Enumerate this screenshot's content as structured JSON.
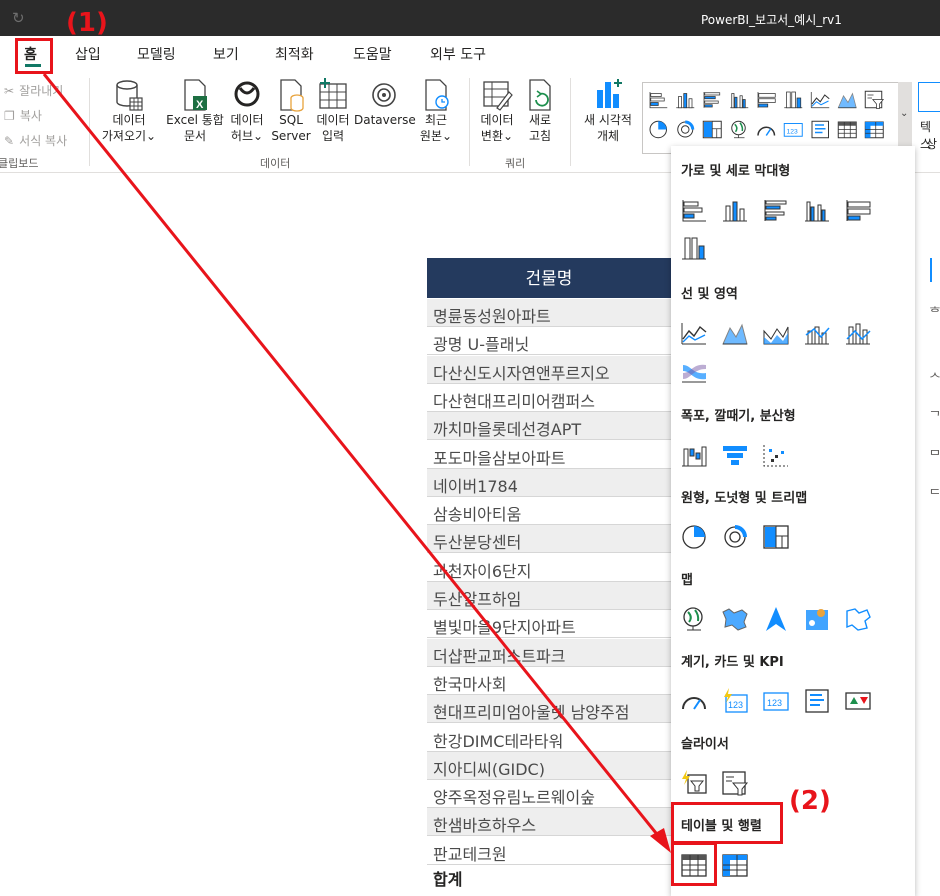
{
  "window": {
    "title": "PowerBI_보고서_예시_rv1"
  },
  "menu": {
    "tabs": [
      "홈",
      "삽입",
      "모델링",
      "보기",
      "최적화",
      "도움말",
      "외부 도구"
    ],
    "active": "홈"
  },
  "ribbon": {
    "clipboard": {
      "cut": "잘라내기",
      "copy": "복사",
      "format_painter": "서식 복사",
      "group": "클립보드"
    },
    "data": {
      "get_data": [
        "데이터",
        "가져오기⌄"
      ],
      "excel": [
        "Excel 통합",
        "문서"
      ],
      "data_hub": [
        "데이터",
        "허브⌄"
      ],
      "sql": [
        "SQL",
        "Server"
      ],
      "enter_data": [
        "데이터",
        "입력"
      ],
      "dataverse": "Dataverse",
      "recent": [
        "최근",
        "원본⌄"
      ],
      "group": "데이터"
    },
    "query": {
      "transform": [
        "데이터",
        "변환⌄"
      ],
      "refresh": [
        "새로",
        "고침"
      ],
      "group": "쿼리"
    },
    "insert": {
      "new_visual": [
        "새 시각적",
        "개체"
      ]
    },
    "text_clip": [
      "텍스",
      "상"
    ]
  },
  "table": {
    "header": "건물명",
    "rows": [
      "명륜동성원아파트",
      "광명 U-플래닛",
      "다산신도시자연앤푸르지오",
      "다산현대프리미어캠퍼스",
      "까치마을롯데선경APT",
      "포도마을삼보아파트",
      "네이버1784",
      "삼송비아티움",
      "두산분당센터",
      "과천자이6단지",
      "두산알프하임",
      "별빛마을9단지아파트",
      "더샵판교퍼스트파크",
      "한국마사회",
      "현대프리미엄아울렛 남양주점",
      "한강DIMC테라타워",
      "지아디씨(GIDC)",
      "양주옥정유림노르웨이숲",
      "한샘바흐하우스",
      "판교테크원"
    ],
    "total_label": "합계"
  },
  "viz_panel": {
    "sections": [
      {
        "title": "가로 및 세로 막대형",
        "icons": [
          "stacked-bar-icon",
          "stacked-column-icon",
          "clustered-bar-icon",
          "clustered-column-icon",
          "100-stacked-bar-icon",
          "100-stacked-column-icon"
        ]
      },
      {
        "title": "선 및 영역",
        "icons": [
          "line-chart-icon",
          "area-chart-icon",
          "stacked-area-icon",
          "line-clustered-column-icon",
          "line-stacked-column-icon",
          "ribbon-chart-icon"
        ]
      },
      {
        "title": "폭포, 깔때기, 분산형",
        "icons": [
          "waterfall-icon",
          "funnel-icon",
          "scatter-icon"
        ]
      },
      {
        "title": "원형, 도넛형 및 트리맵",
        "icons": [
          "pie-icon",
          "donut-icon",
          "treemap-icon"
        ]
      },
      {
        "title": "맵",
        "icons": [
          "map-icon",
          "filled-map-icon",
          "azure-map-icon",
          "arcgis-map-icon",
          "shape-map-icon"
        ]
      },
      {
        "title": "계기, 카드 및 KPI",
        "icons": [
          "gauge-icon",
          "card-new-icon",
          "card-icon",
          "multi-row-card-icon",
          "kpi-icon"
        ]
      },
      {
        "title": "슬라이서",
        "icons": [
          "slicer-new-icon",
          "slicer-icon"
        ]
      },
      {
        "title": "테이블 및 행렬",
        "icons": [
          "table-visual-icon",
          "matrix-visual-icon"
        ]
      }
    ]
  },
  "annotations": {
    "step1": "(1)",
    "step2": "(2)"
  },
  "colors": {
    "annotation": "#e8141b",
    "accent": "#117865",
    "table_header": "#243a5e",
    "powerbi_yellow": "#f2c811",
    "chart_blue": "#118dff"
  }
}
